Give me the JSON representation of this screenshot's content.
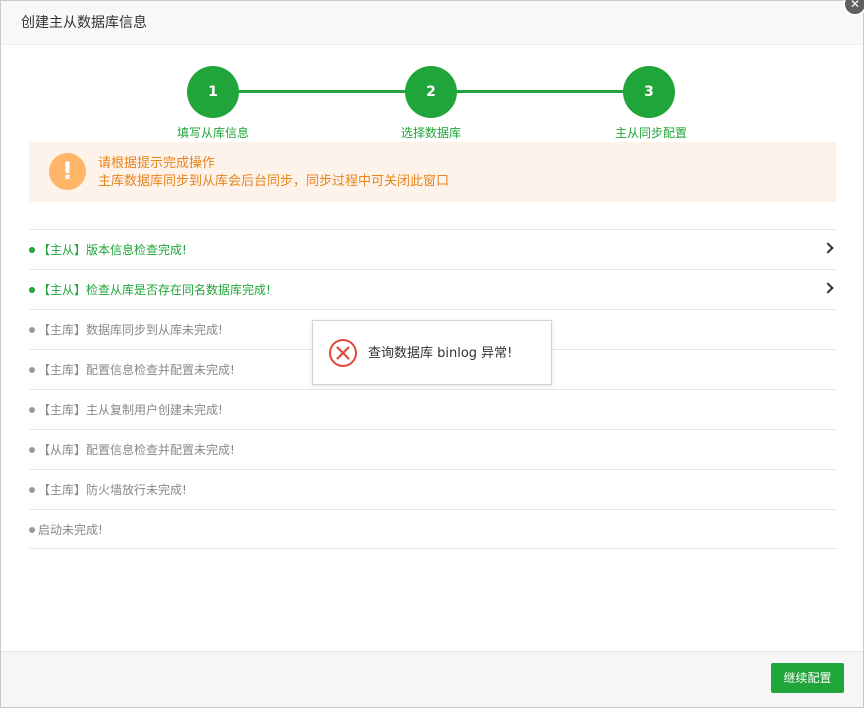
{
  "dialog": {
    "title": "创建主从数据库信息",
    "close_glyph": "✕"
  },
  "steps": [
    {
      "number": "1",
      "label": "填写从库信息"
    },
    {
      "number": "2",
      "label": "选择数据库"
    },
    {
      "number": "3",
      "label": "主从同步配置"
    }
  ],
  "notice": {
    "icon_glyph": "!",
    "line1": "请根据提示完成操作",
    "line2": "主库数据库同步到从库会后台同步，同步过程中可关闭此窗口"
  },
  "tasks": [
    {
      "text": "【主从】版本信息检查完成!",
      "status": "done"
    },
    {
      "text": "【主从】检查从库是否存在同名数据库完成!",
      "status": "done"
    },
    {
      "text": "【主库】数据库同步到从库未完成!",
      "status": "pending"
    },
    {
      "text": "【主库】配置信息检查并配置未完成!",
      "status": "pending"
    },
    {
      "text": "【主库】主从复制用户创建未完成!",
      "status": "pending"
    },
    {
      "text": "【从库】配置信息检查并配置未完成!",
      "status": "pending"
    },
    {
      "text": "【主库】防火墙放行未完成!",
      "status": "pending"
    },
    {
      "text": "启动未完成!",
      "status": "pending"
    }
  ],
  "toast": {
    "message": "查询数据库 binlog 异常!",
    "icon": "error-circle-icon"
  },
  "footer": {
    "continue_label": "继续配置"
  },
  "colors": {
    "accent": "#20a53a",
    "warning": "#e6841d",
    "warning_bg": "#fdf3ea",
    "error": "#e0483e"
  }
}
